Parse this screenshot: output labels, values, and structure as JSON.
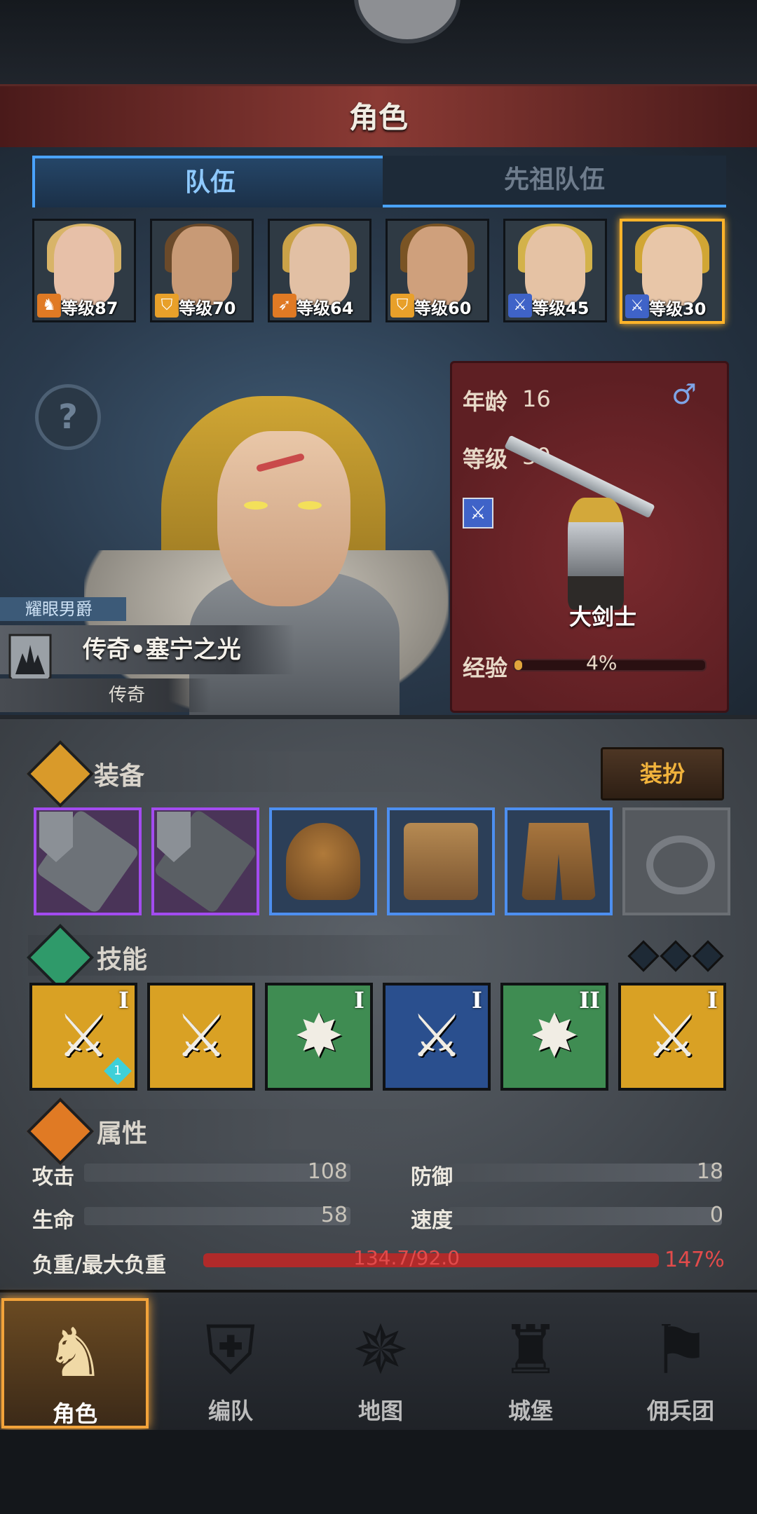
{
  "header": {
    "title": "角色"
  },
  "tabs": [
    {
      "label": "队伍"
    },
    {
      "label": "先祖队伍"
    }
  ],
  "team": [
    {
      "level": "等级87",
      "class_icon": "beast-icon",
      "face": "#e7c0a8",
      "hair": "#d8b468",
      "class_bg": "#e07a24"
    },
    {
      "level": "等级70",
      "class_icon": "shield-icon",
      "face": "#c89a76",
      "hair": "#6b4a2a",
      "class_bg": "#e8a02a"
    },
    {
      "level": "等级64",
      "class_icon": "bow-icon",
      "face": "#e2c0a4",
      "hair": "#caa248",
      "class_bg": "#e07a24"
    },
    {
      "level": "等级60",
      "class_icon": "shield-icon",
      "face": "#cfa07c",
      "hair": "#7a5424",
      "class_bg": "#e8a02a"
    },
    {
      "level": "等级45",
      "class_icon": "sword-icon",
      "face": "#e5c2a4",
      "hair": "#d3b24a",
      "class_bg": "#3f63c8"
    },
    {
      "level": "等级30",
      "class_icon": "sword-icon",
      "face": "#e8c6a8",
      "hair": "#d1a634",
      "class_bg": "#3f63c8"
    }
  ],
  "hero": {
    "title": "耀眼男爵",
    "name": "传奇•塞宁之光",
    "rarity": "传奇",
    "age_label": "年龄",
    "age": "16",
    "level_label": "等级",
    "level": "30",
    "gender": "♂",
    "class_name": "大剑士",
    "exp_label": "经验",
    "exp_percent": 4,
    "exp_text": "4%"
  },
  "equipment": {
    "title": "装备",
    "dress_button": "装扮",
    "slots": [
      {
        "name": "weapon-slot-1-icon",
        "style": "purple"
      },
      {
        "name": "weapon-slot-2-icon",
        "style": "purple"
      },
      {
        "name": "helmet-icon",
        "style": "blue"
      },
      {
        "name": "armor-icon",
        "style": "blue"
      },
      {
        "name": "boots-icon",
        "style": "blue"
      },
      {
        "name": "ring-icon",
        "style": "empty"
      }
    ]
  },
  "skills": {
    "title": "技能",
    "items": [
      {
        "rank": "I",
        "bg": "#d9a124",
        "glyph": "⚔",
        "badge": "1"
      },
      {
        "rank": "",
        "bg": "#d9a124",
        "glyph": "⚔"
      },
      {
        "rank": "I",
        "bg": "#3f8c52",
        "glyph": "✸"
      },
      {
        "rank": "I",
        "bg": "#2a4f8e",
        "glyph": "⚔"
      },
      {
        "rank": "II",
        "bg": "#3f8c52",
        "glyph": "✸"
      },
      {
        "rank": "I",
        "bg": "#d9a124",
        "glyph": "⚔"
      }
    ]
  },
  "attributes": {
    "title": "属性",
    "attack_label": "攻击",
    "attack": "108",
    "defense_label": "防御",
    "defense": "18",
    "hp_label": "生命",
    "hp": "58",
    "speed_label": "速度",
    "speed": "0",
    "load_label": "负重/最大负重",
    "load": "134.7/92.0",
    "load_percent": "147%"
  },
  "nav": [
    {
      "label": "角色",
      "icon": "knight-icon",
      "glyph": "♞"
    },
    {
      "label": "编队",
      "icon": "helmet-icon",
      "glyph": "⛨"
    },
    {
      "label": "地图",
      "icon": "compass-icon",
      "glyph": "✵"
    },
    {
      "label": "城堡",
      "icon": "castle-icon",
      "glyph": "♜"
    },
    {
      "label": "佣兵团",
      "icon": "mercenary-icon",
      "glyph": "⚑"
    }
  ],
  "colors": {
    "accent": "#ffb42a",
    "tab_active": "#4aa3ff",
    "load_red": "#e24b4b"
  }
}
